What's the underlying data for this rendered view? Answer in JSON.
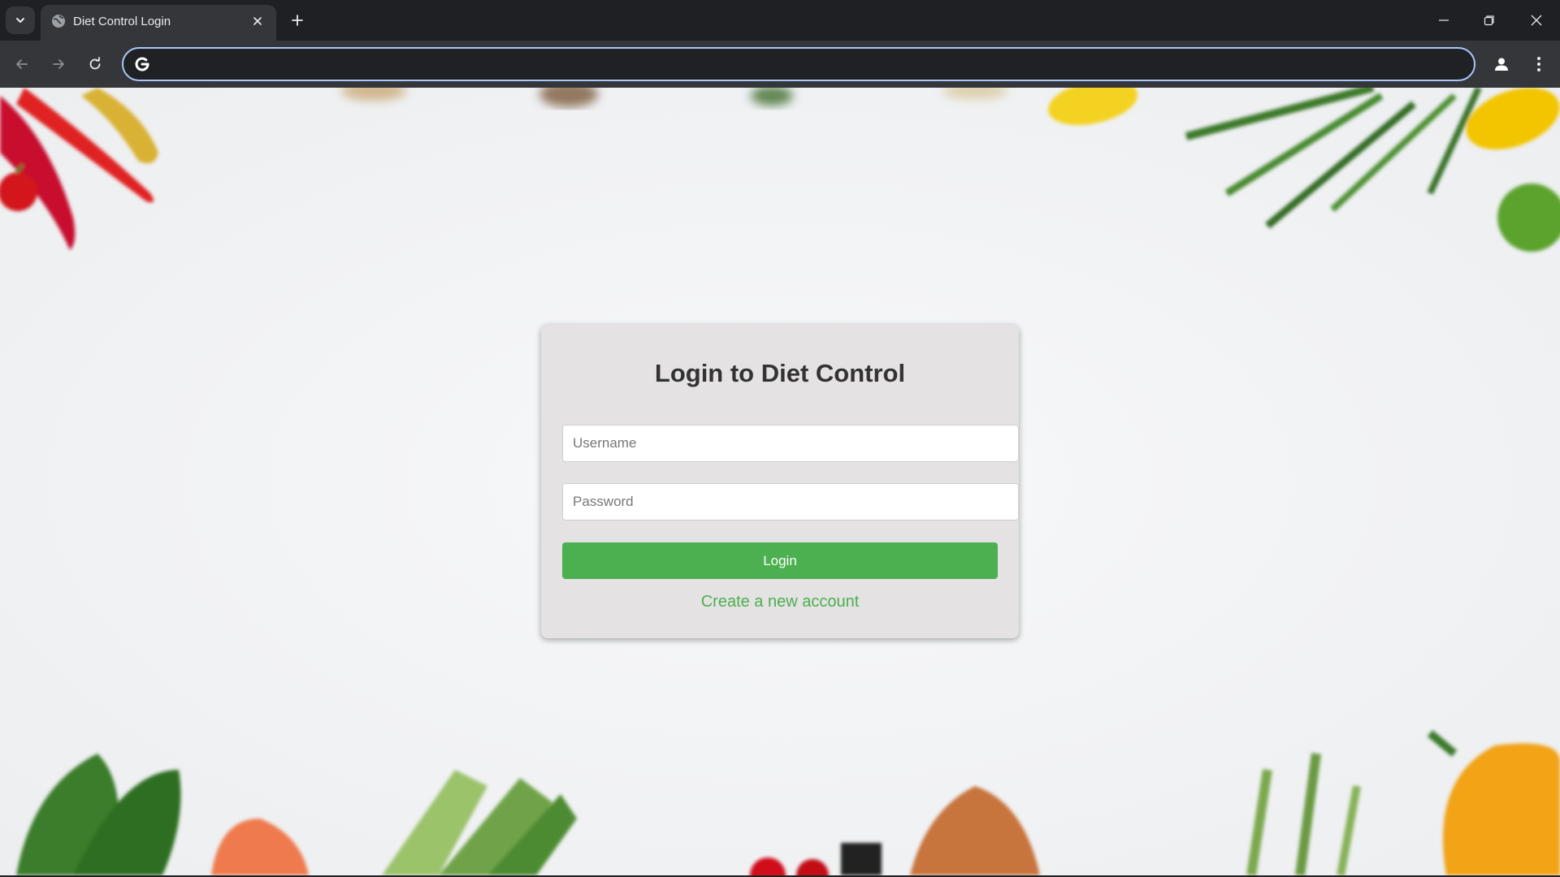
{
  "browser": {
    "tab_title": "Diet Control Login",
    "address_value": "",
    "colors": {
      "frame": "#1f2023",
      "toolbar": "#35363a",
      "omnibox_focus": "#a8c7fa"
    }
  },
  "login": {
    "title": "Login to Diet Control",
    "username_placeholder": "Username",
    "password_placeholder": "Password",
    "login_label": "Login",
    "create_account_label": "Create a new account"
  },
  "theme": {
    "accent": "#4caf50",
    "card_bg": "#e4e2e2",
    "title_color": "#333333"
  },
  "icons": [
    "chevron-down-icon",
    "globe-icon",
    "close-icon",
    "plus-icon",
    "minimize-icon",
    "restore-icon",
    "back-arrow-icon",
    "forward-arrow-icon",
    "reload-icon",
    "google-g-icon",
    "profile-icon",
    "more-vert-icon"
  ]
}
